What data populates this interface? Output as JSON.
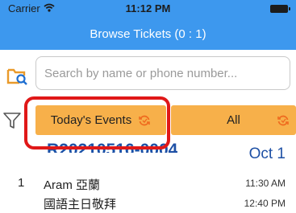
{
  "status_bar": {
    "carrier": "Carrier",
    "time": "11:12 PM"
  },
  "header": {
    "title": "Browse Tickets (0 : 1)"
  },
  "search": {
    "placeholder": "Search by name or phone number...",
    "value": ""
  },
  "filters": {
    "today_label": "Today's Events",
    "all_label": "All"
  },
  "ticket": {
    "id": "R20210516-0004",
    "date": "Oct 1",
    "index": "1",
    "name": "Aram 亞蘭",
    "time": "11:30 AM",
    "event": "國語主日敬拜",
    "event_time": "12:40 PM"
  },
  "colors": {
    "header": "#3d98ee",
    "button": "#f7b04a",
    "highlight": "#e01818",
    "ticket_text": "#1e50a5"
  },
  "icons": [
    "wifi-icon",
    "battery-icon",
    "folder-search-icon",
    "filter-icon",
    "refresh-icon"
  ]
}
